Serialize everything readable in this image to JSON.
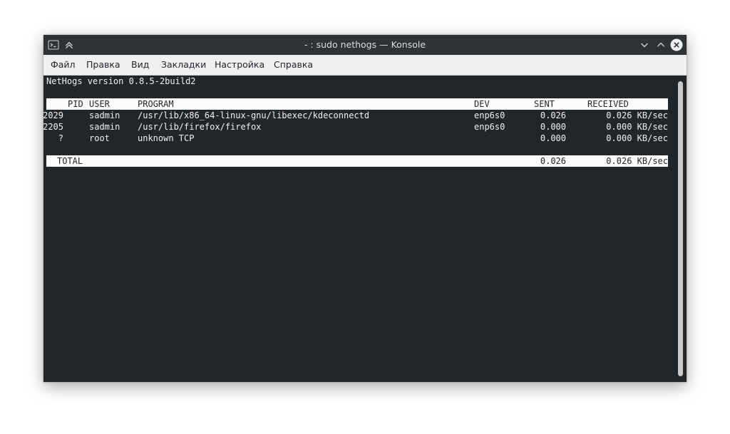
{
  "window": {
    "title": "- : sudo nethogs — Konsole",
    "icons": {
      "app": "terminal-icon",
      "pin": "keep-above-icon",
      "minimize": "chevron-down-icon",
      "maximize": "chevron-up-icon",
      "close": "close-icon"
    }
  },
  "menu": {
    "items": [
      "Файл",
      "Правка",
      "Вид",
      "Закладки",
      "Настройка",
      "Справка"
    ]
  },
  "terminal": {
    "version_line": "NetHogs version 0.8.5-2build2",
    "headers": {
      "pid": "PID",
      "user": "USER",
      "program": "PROGRAM",
      "dev": "DEV",
      "sent": "SENT",
      "received": "RECEIVED"
    },
    "rows": [
      {
        "pid": "2029",
        "user": "sadmin",
        "program": "/usr/lib/x86_64-linux-gnu/libexec/kdeconnectd",
        "dev": "enp6s0",
        "sent": "0.026",
        "received": "0.026 KB/sec"
      },
      {
        "pid": "2205",
        "user": "sadmin",
        "program": "/usr/lib/firefox/firefox",
        "dev": "enp6s0",
        "sent": "0.000",
        "received": "0.000 KB/sec"
      },
      {
        "pid": "?",
        "user": "root",
        "program": "unknown TCP",
        "dev": "",
        "sent": "0.000",
        "received": "0.000 KB/sec"
      }
    ],
    "total": {
      "label": "TOTAL",
      "sent": "0.026",
      "received": "0.026 KB/sec"
    }
  },
  "colors": {
    "terminal_bg": "#232629",
    "terminal_fg": "#eff0f1",
    "titlebar_bg": "#2f3337",
    "menubar_bg": "#eff0f1",
    "close_button": "#eff0f1"
  }
}
